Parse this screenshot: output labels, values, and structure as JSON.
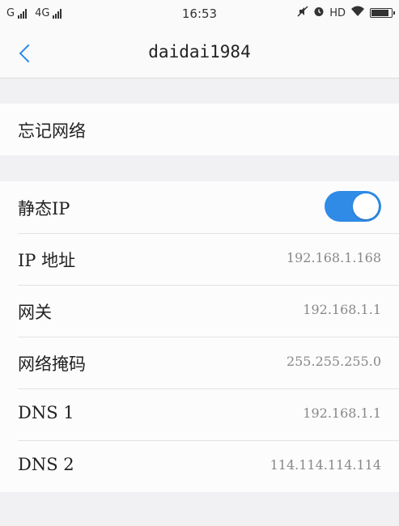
{
  "status_bar": {
    "sim1": "G",
    "sim2": "4G",
    "time": "16:53",
    "hd": "HD",
    "battery_level": 0.9
  },
  "nav": {
    "title": "daidai1984"
  },
  "forget": {
    "label": "忘记网络"
  },
  "settings": {
    "static_ip_label": "静态IP",
    "static_ip_on": true,
    "rows": [
      {
        "label": "IP 地址",
        "value": "192.168.1.168"
      },
      {
        "label": "网关",
        "value": "192.168.1.1"
      },
      {
        "label": "网络掩码",
        "value": "255.255.255.0"
      },
      {
        "label": "DNS 1",
        "value": "192.168.1.1"
      },
      {
        "label": "DNS 2",
        "value": "114.114.114.114"
      }
    ]
  },
  "colors": {
    "accent": "#2f8be6"
  }
}
